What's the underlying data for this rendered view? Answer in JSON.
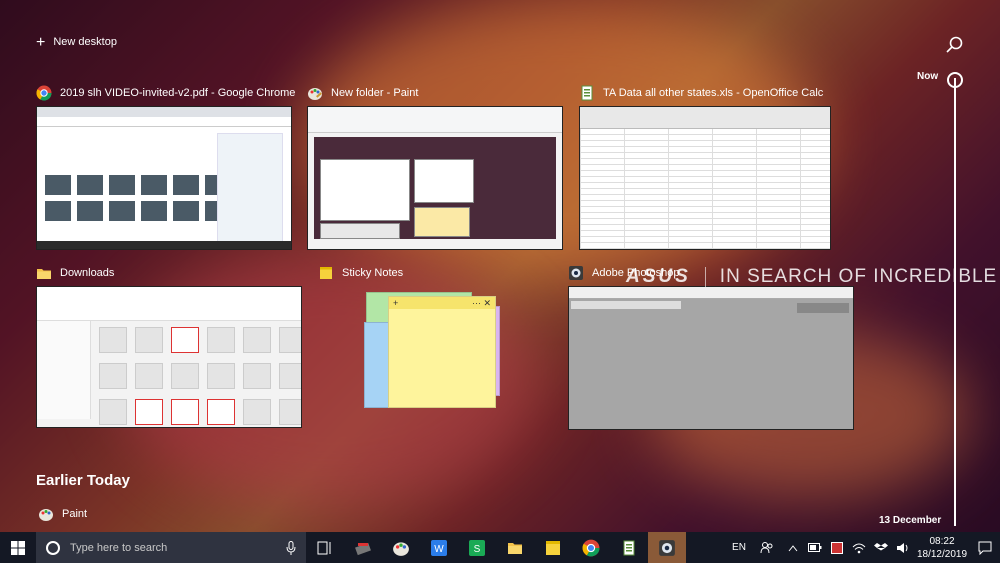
{
  "new_desktop_label": "New desktop",
  "windows": [
    {
      "title": "2019 slh VIDEO-invited-v2.pdf - Google Chrome",
      "icon": "chrome-icon"
    },
    {
      "title": "New folder - Paint",
      "icon": "paint-icon"
    },
    {
      "title": "TA Data all other states.xls - OpenOffice Calc",
      "icon": "openoffice-calc-icon"
    },
    {
      "title": "Downloads",
      "icon": "folder-icon"
    },
    {
      "title": "Sticky Notes",
      "icon": "sticky-notes-icon"
    },
    {
      "title": "Adobe Photoshop",
      "icon": "photoshop-icon"
    }
  ],
  "wallpaper_brand": {
    "logo": "ASUS",
    "tagline": "IN SEARCH OF INCREDIBLE"
  },
  "timeline": {
    "now_label": "Now",
    "date_label": "13 December"
  },
  "earlier": {
    "heading": "Earlier Today",
    "items": [
      {
        "title": "Paint",
        "icon": "paint-icon"
      }
    ]
  },
  "taskbar": {
    "search_placeholder": "Type here to search",
    "language": "EN",
    "time": "08:22",
    "date": "18/12/2019",
    "pinned": [
      "app-icon",
      "paint-icon",
      "wps-writer-icon",
      "wps-spreadsheet-icon",
      "file-explorer-icon",
      "sticky-notes-icon",
      "chrome-icon",
      "openoffice-calc-icon",
      "photoshop-icon"
    ]
  },
  "colors": {
    "taskbar": "#141824",
    "search_box": "#2f3340",
    "active_task": "#8a5a38"
  }
}
